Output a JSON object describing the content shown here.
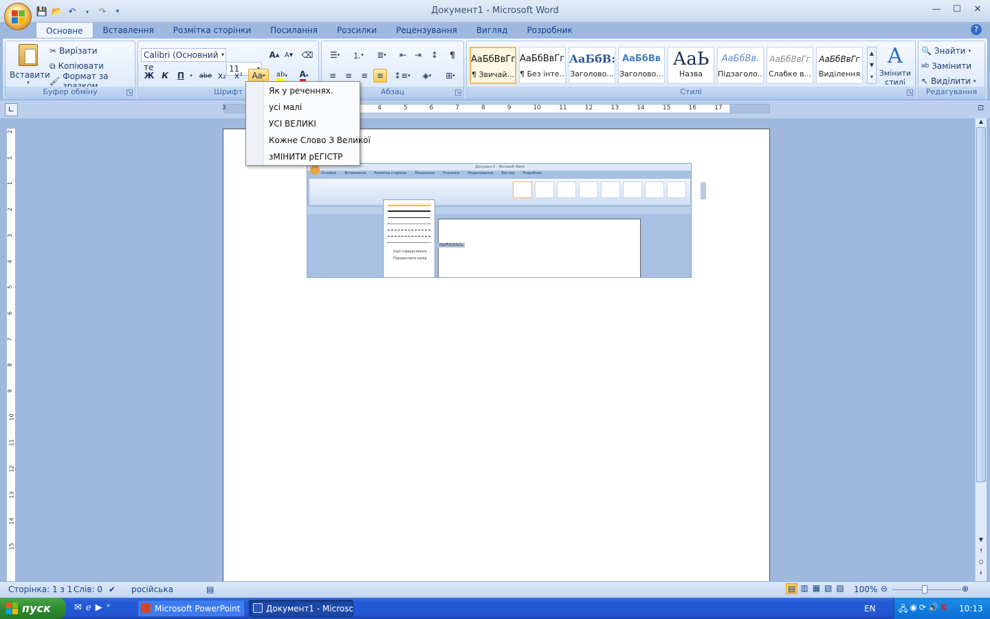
{
  "window": {
    "title": "Документ1 - Microsoft Word",
    "minimize": "—",
    "maximize": "☐",
    "close": "✕"
  },
  "tabs": [
    "Основне",
    "Вставлення",
    "Розмітка сторінки",
    "Посилання",
    "Розсилки",
    "Рецензування",
    "Вигляд",
    "Розробник"
  ],
  "ribbon": {
    "clipboard": {
      "label": "Буфер обміну",
      "paste": "Вставити",
      "cut": "Вирізати",
      "copy": "Копіювати",
      "format_painter": "Формат за зразком"
    },
    "font": {
      "label": "Шрифт",
      "font_name": "Calibri (Основний те",
      "font_size": "11",
      "bold": "Ж",
      "italic": "К",
      "underline": "П",
      "strike": "abe",
      "sub": "x₂",
      "sup": "x²",
      "case": "Аа",
      "highlight": "ab",
      "color": "A",
      "grow": "A",
      "shrink": "A"
    },
    "paragraph": {
      "label": "Абзац"
    },
    "styles": {
      "label": "Стилі",
      "change_styles": "Змінити стилі",
      "items": [
        {
          "preview": "АаБбВвГг,",
          "name": "¶ Звичай..."
        },
        {
          "preview": "АаБбВвГг,",
          "name": "¶ Без інте..."
        },
        {
          "preview": "АаБбВ:",
          "name": "Заголово..."
        },
        {
          "preview": "АаБбВв",
          "name": "Заголово..."
        },
        {
          "preview": "АаЬ",
          "name": "Назва"
        },
        {
          "preview": "АаБбВв.",
          "name": "Підзаголо..."
        },
        {
          "preview": "АаБбВвГг",
          "name": "Слабке в..."
        },
        {
          "preview": "АаБбВвГг",
          "name": "Виділення"
        }
      ]
    },
    "editing": {
      "label": "Редагування",
      "find": "Знайти",
      "replace": "Замінити",
      "select": "Виділити"
    }
  },
  "case_menu": [
    "Як у реченнях.",
    "усі малі",
    "УСІ ВЕЛИКІ",
    "Кожне Слово З Великої",
    "зМІНИТИ рЕГІСТР"
  ],
  "ruler": {
    "h_labels": [
      "3",
      "2",
      "1",
      "1",
      "2",
      "3",
      "4",
      "5",
      "6",
      "7",
      "8",
      "9",
      "10",
      "11",
      "12",
      "13",
      "14",
      "15",
      "16",
      "17"
    ],
    "v_labels": [
      "2",
      "1",
      "1",
      "2",
      "3",
      "4",
      "5",
      "6",
      "7",
      "8",
      "9",
      "10",
      "11",
      "12",
      "13",
      "14",
      "15"
    ]
  },
  "embedded": {
    "title": "Документ1 - Microsoft Word",
    "tabs": [
      "Основне",
      "Вставлення",
      "Розмітка сторінки",
      "Посилання",
      "Розсилки",
      "Рецензування",
      "Вигляд",
      "Розробник"
    ],
    "selected_text": "fdsffdsfdsfa",
    "menu_more": "Інші підкреслення...",
    "menu_color": "Підкреслити колір"
  },
  "status": {
    "page": "Сторінка: 1 з 1",
    "words": "Слів: 0",
    "language": "російська",
    "zoom": "100%"
  },
  "taskbar": {
    "start": "пуск",
    "items": [
      "Microsoft PowerPoint ...",
      "Документ1 - Microso..."
    ],
    "lang": "EN",
    "time": "10:13"
  }
}
